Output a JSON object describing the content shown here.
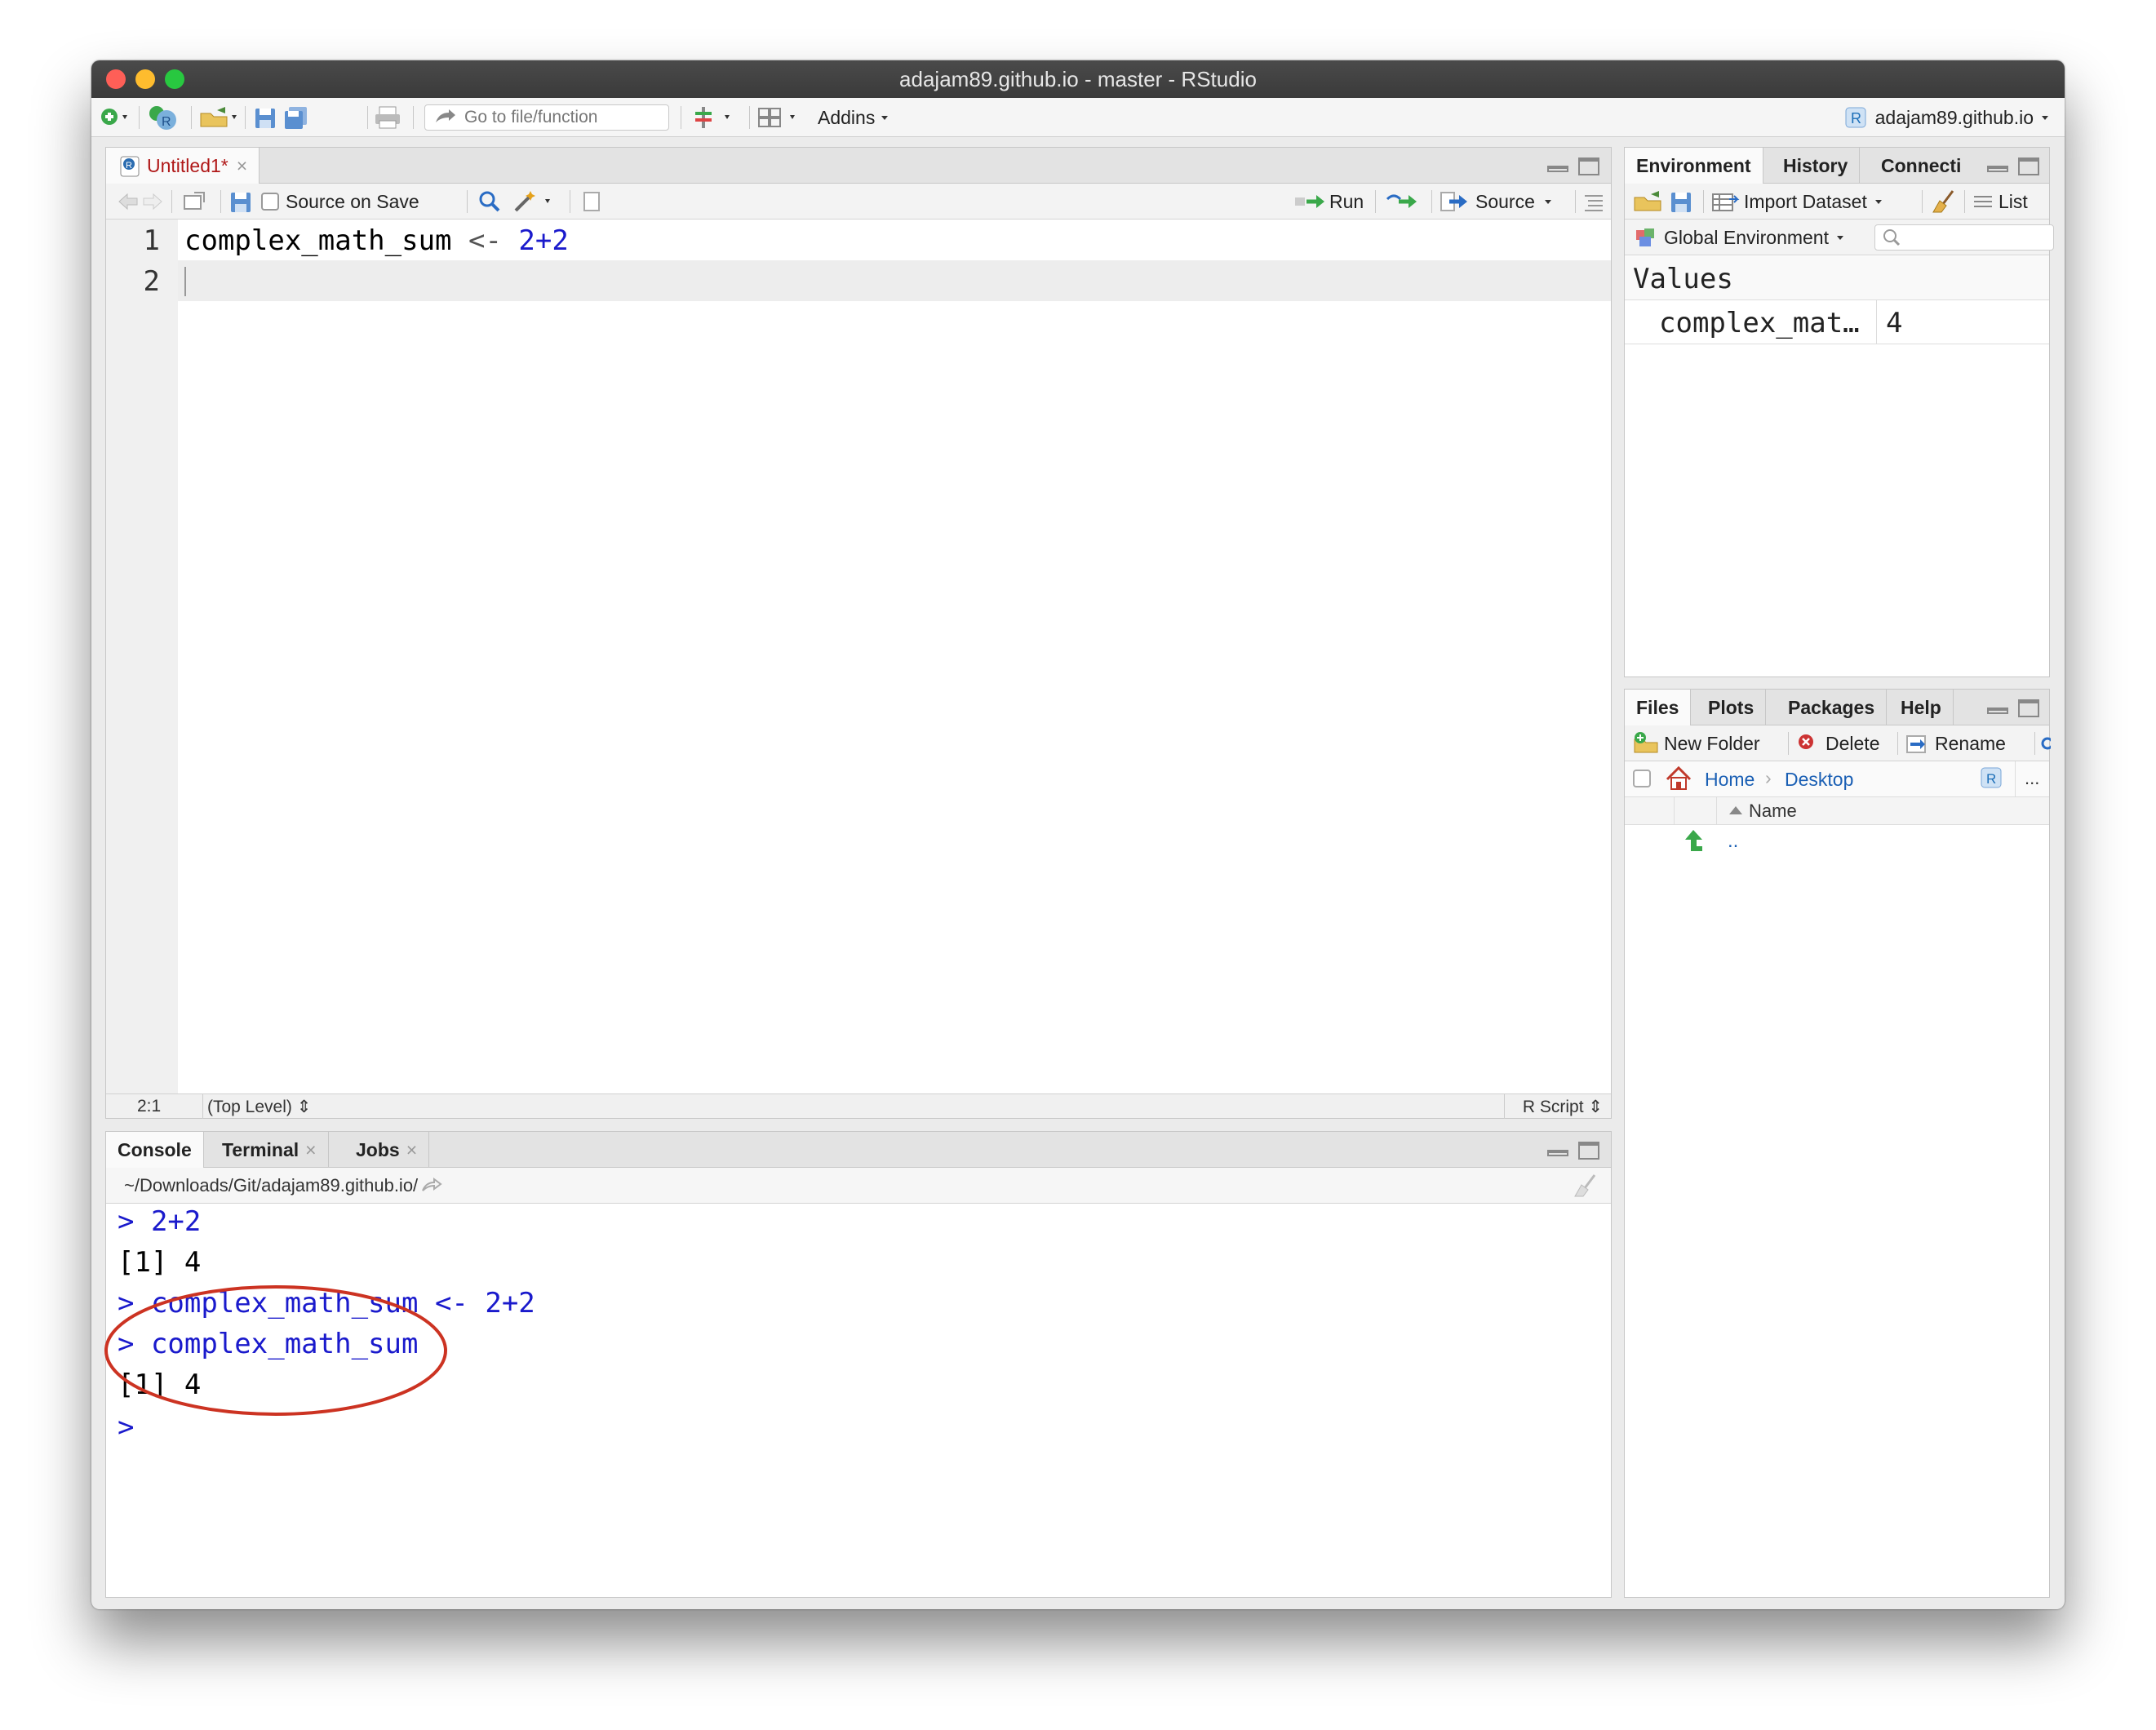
{
  "window": {
    "title": "adajam89.github.io - master - RStudio"
  },
  "toolbar": {
    "goto_placeholder": "Go to file/function",
    "addins_label": "Addins",
    "project_label": "adajam89.github.io"
  },
  "editor": {
    "tab_label": "Untitled1*",
    "source_on_save_label": "Source on Save",
    "run_label": "Run",
    "source_label": "Source",
    "lines": [
      {
        "num": "1",
        "code_var": "complex_math_sum",
        "code_op": " <- ",
        "code_val": "2+2"
      },
      {
        "num": "2"
      }
    ],
    "status_position": "2:1",
    "status_scope": "(Top Level)",
    "status_type": "R Script"
  },
  "console": {
    "tabs": [
      "Console",
      "Terminal",
      "Jobs"
    ],
    "path": "~/Downloads/Git/adajam89.github.io/",
    "lines": [
      {
        "prompt": "> ",
        "text": "2+2"
      },
      {
        "prompt": "",
        "text": "[1] 4"
      },
      {
        "prompt": "> ",
        "text": "complex_math_sum <- 2+2"
      },
      {
        "prompt": "> ",
        "text": "complex_math_sum"
      },
      {
        "prompt": "",
        "text": "[1] 4"
      },
      {
        "prompt": ">",
        "text": ""
      }
    ],
    "annotation_color": "#cc3322"
  },
  "environment": {
    "tabs": [
      "Environment",
      "History",
      "Connecti"
    ],
    "import_label": "Import Dataset",
    "list_label": "List",
    "scope_label": "Global Environment",
    "section_label": "Values",
    "values": [
      {
        "name": "complex_mat…",
        "value": "4"
      }
    ]
  },
  "files": {
    "tabs": [
      "Files",
      "Plots",
      "Packages",
      "Help"
    ],
    "new_folder_label": "New Folder",
    "delete_label": "Delete",
    "rename_label": "Rename",
    "breadcrumb_home": "Home",
    "breadcrumb_desktop": "Desktop",
    "more_label": "...",
    "column_name": "Name",
    "parent_dir": ".."
  }
}
